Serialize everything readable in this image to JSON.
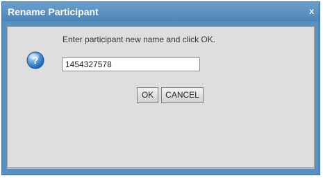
{
  "dialog": {
    "title": "Rename Participant",
    "close_label": "x",
    "prompt": "Enter participant new name and click OK.",
    "input_value": "1454327578",
    "ok_label": "OK",
    "cancel_label": "CANCEL",
    "icon": "question-icon"
  },
  "colors": {
    "titlebar": "#5b8fbd",
    "content_bg": "#dedede",
    "icon_blue": "#2d6fbe"
  }
}
